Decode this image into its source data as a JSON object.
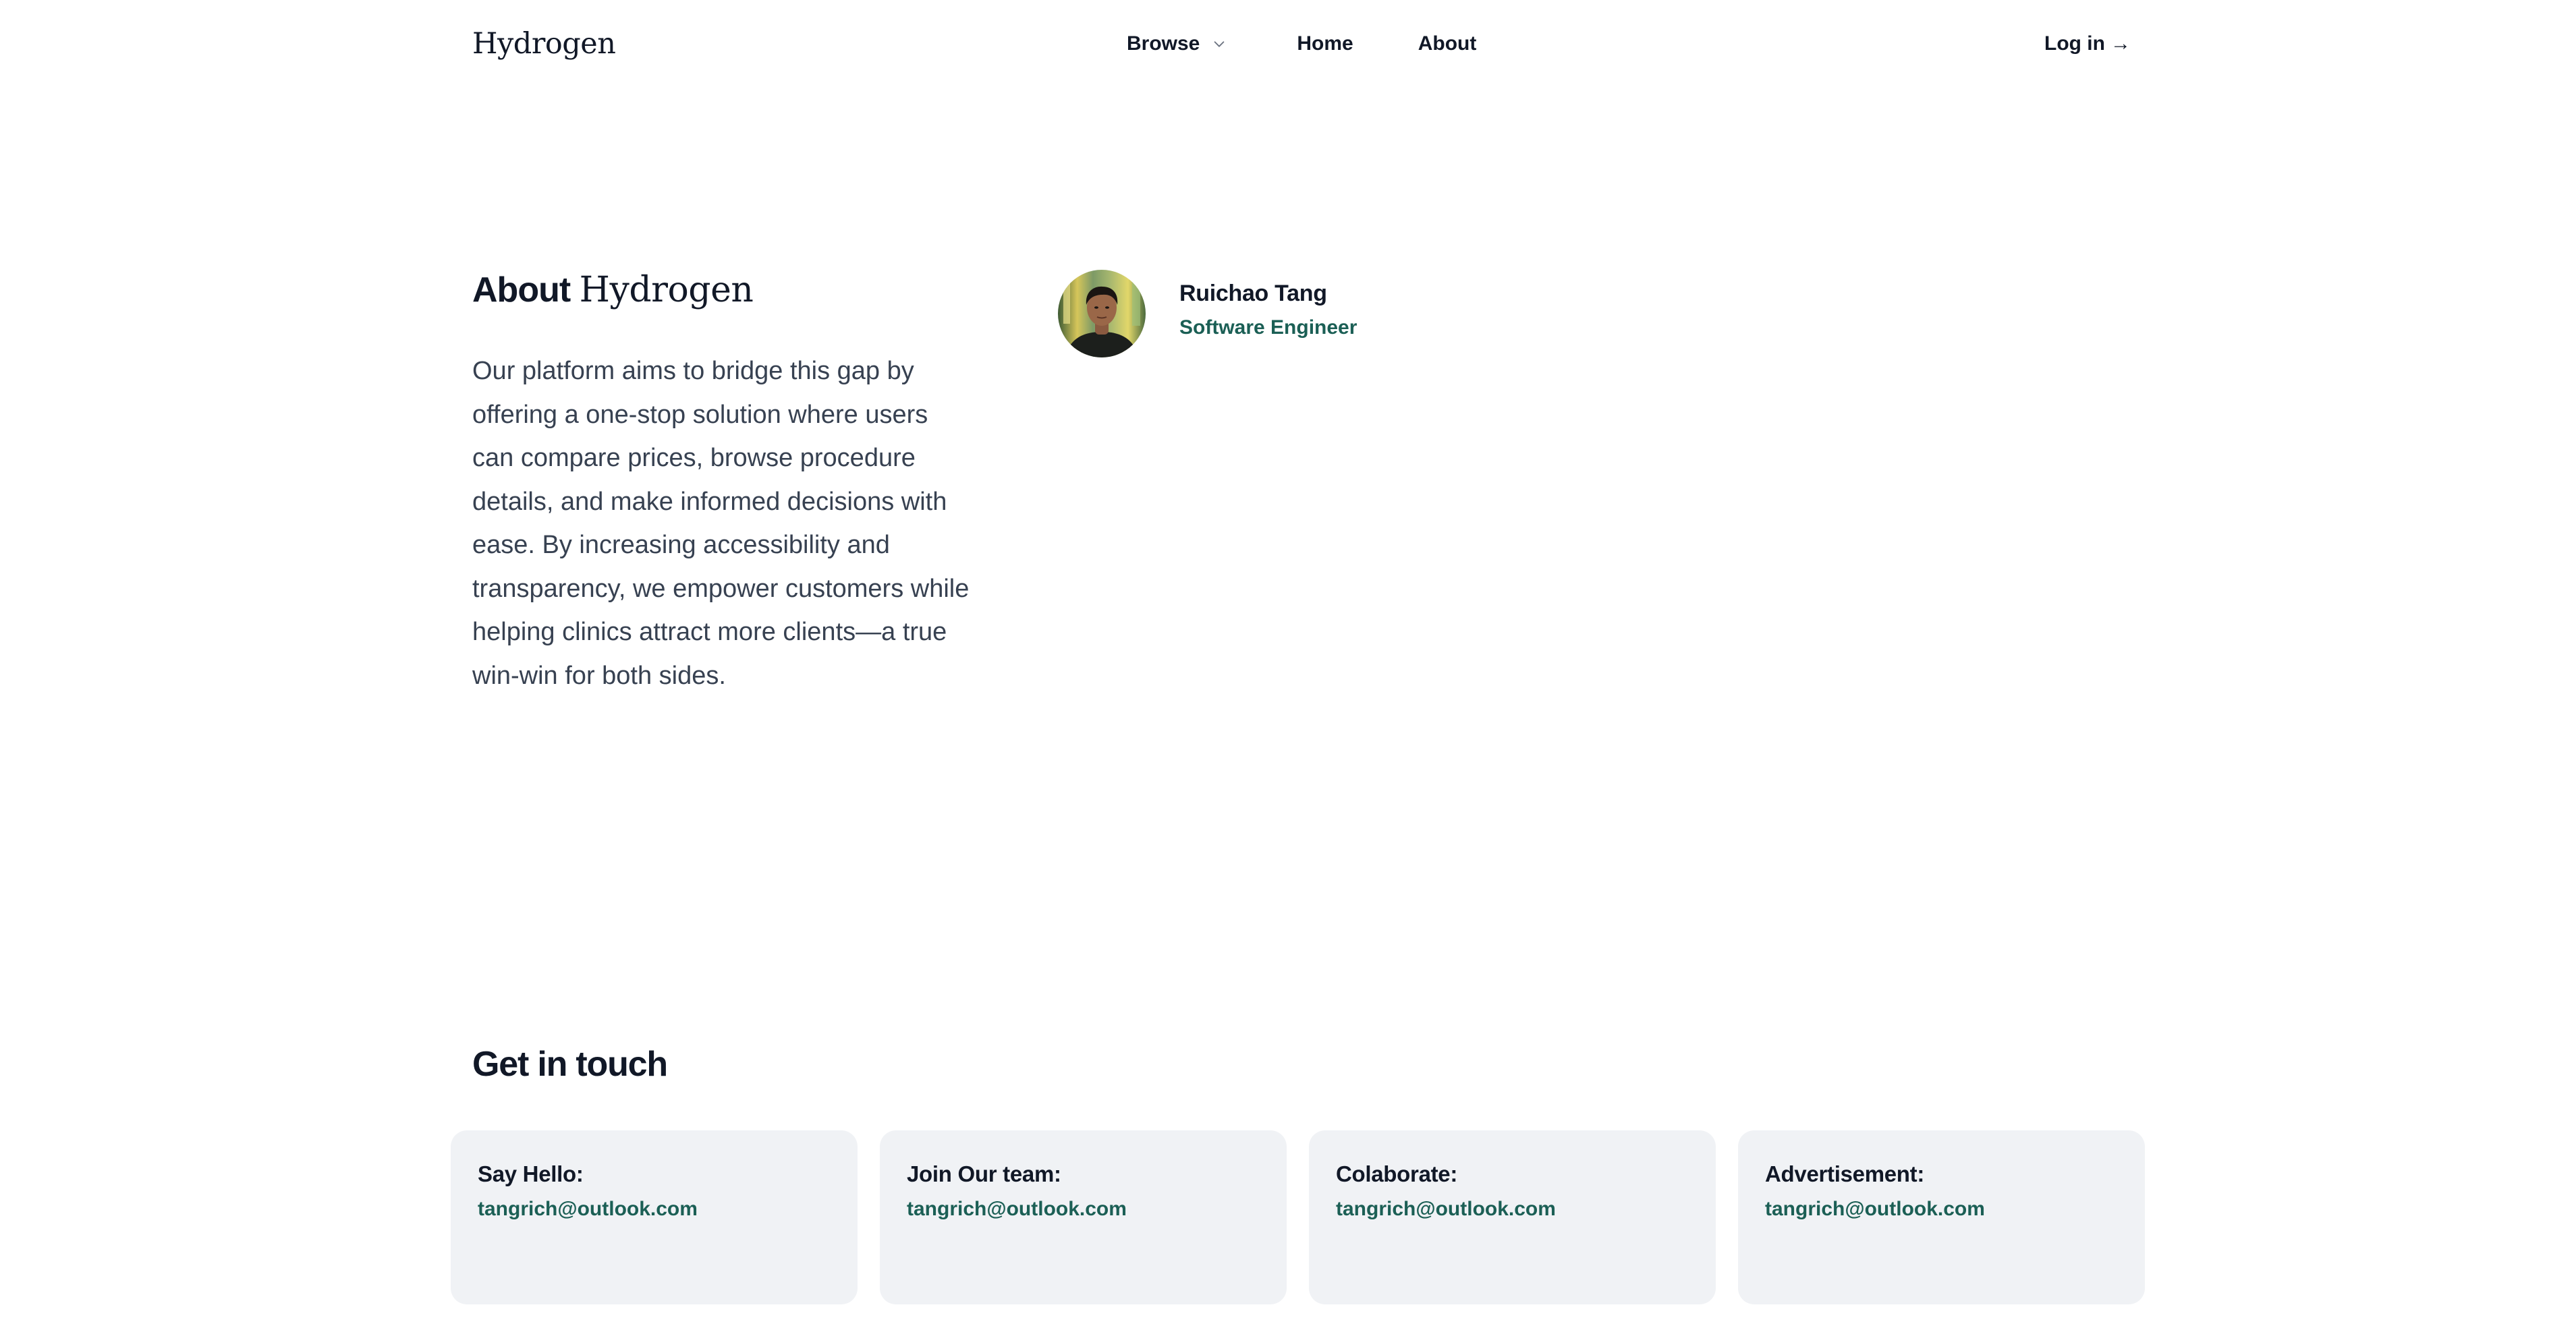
{
  "header": {
    "logo": "Hydrogen",
    "nav": {
      "browse": "Browse",
      "home": "Home",
      "about": "About"
    },
    "login": "Log in",
    "login_arrow": "→",
    "icons": {
      "browse_dropdown": "chevron-down-icon"
    }
  },
  "about": {
    "title_prefix": "About",
    "title_brand": "Hydrogen",
    "description": "Our platform aims to bridge this gap by offering a one-stop solution where users can compare prices, browse procedure details, and make informed decisions with ease. By increasing accessibility and transparency, we empower customers while helping clinics attract more clients—a true win-win for both sides."
  },
  "team": [
    {
      "name": "Ruichao Tang",
      "role": "Software Engineer"
    }
  ],
  "contact": {
    "title": "Get in touch",
    "cards": [
      {
        "label": "Say Hello:",
        "email": "tangrich@outlook.com"
      },
      {
        "label": "Join Our team:",
        "email": "tangrich@outlook.com"
      },
      {
        "label": "Colaborate:",
        "email": "tangrich@outlook.com"
      },
      {
        "label": "Advertisement:",
        "email": "tangrich@outlook.com"
      }
    ]
  },
  "colors": {
    "accent": "#1b5f55",
    "text": "#111827",
    "body_text": "#374151",
    "card_bg": "#f0f2f5"
  }
}
